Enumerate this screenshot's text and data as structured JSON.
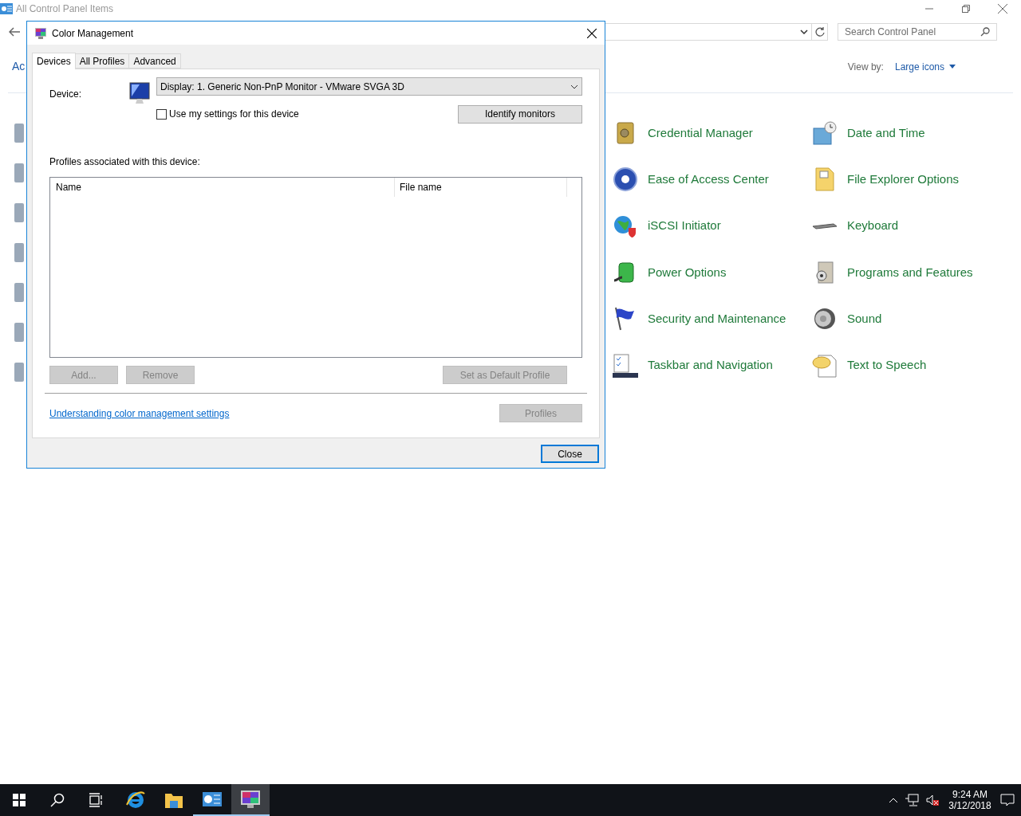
{
  "explorer": {
    "title": "All Control Panel Items",
    "search": {
      "placeholder": "Search Control Panel"
    },
    "heading": "Ac",
    "view_by": {
      "label": "View by:",
      "value": "Large icons"
    },
    "items": [
      {
        "label": "Credential Manager"
      },
      {
        "label": "Date and Time"
      },
      {
        "label": "Ease of Access Center"
      },
      {
        "label": "File Explorer Options"
      },
      {
        "label": "iSCSI Initiator"
      },
      {
        "label": "Keyboard"
      },
      {
        "label": "Power Options"
      },
      {
        "label": "Programs and Features"
      },
      {
        "label": "Security and Maintenance"
      },
      {
        "label": "Sound"
      },
      {
        "label": "Taskbar and Navigation"
      },
      {
        "label": "Text to Speech"
      }
    ]
  },
  "dialog": {
    "title": "Color Management",
    "tabs": [
      {
        "label": "Devices",
        "selected": true
      },
      {
        "label": "All Profiles",
        "selected": false
      },
      {
        "label": "Advanced",
        "selected": false
      }
    ],
    "device_label": "Device:",
    "device": "Display: 1. Generic Non-PnP Monitor - VMware SVGA 3D",
    "use_my_settings": {
      "label": "Use my settings for this device",
      "checked": false
    },
    "identify_button": "Identify monitors",
    "profiles_label": "Profiles associated with this device:",
    "columns": [
      "Name",
      "File name"
    ],
    "buttons": [
      {
        "label": "Add...",
        "disabled": true
      },
      {
        "label": "Remove",
        "disabled": true
      },
      {
        "label": "Set as Default Profile",
        "disabled": true
      }
    ],
    "link": "Understanding color management settings",
    "profiles_button": {
      "label": "Profiles",
      "disabled": true
    },
    "close_button": "Close"
  },
  "taskbar": {
    "apps": [
      {
        "running": false,
        "selected": false
      },
      {
        "running": false,
        "selected": false
      },
      {
        "running": true,
        "selected": false
      },
      {
        "running": true,
        "selected": true
      }
    ],
    "time": "9:24 AM",
    "date": "3/12/2018"
  }
}
